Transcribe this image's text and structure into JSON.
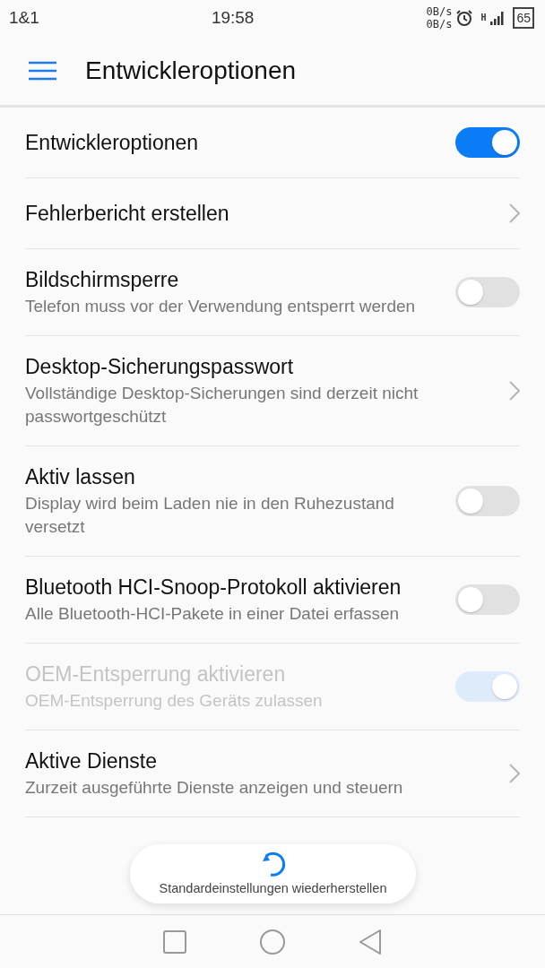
{
  "status_bar": {
    "carrier": "1&1",
    "time": "19:58",
    "upload_speed": "0B/s",
    "download_speed": "0B/s",
    "network_type": "H",
    "battery": "65"
  },
  "toolbar": {
    "title": "Entwickleroptionen"
  },
  "settings": [
    {
      "kind": "switch",
      "title": "Entwickleroptionen",
      "on": true,
      "disabled": false
    },
    {
      "kind": "link",
      "title": "Fehlerbericht erstellen",
      "disabled": false
    },
    {
      "kind": "switch",
      "title": "Bildschirmsperre",
      "subtitle": "Telefon muss vor der Verwendung entsperrt werden",
      "on": false,
      "disabled": false
    },
    {
      "kind": "link",
      "title": "Desktop-Sicherungspasswort",
      "subtitle": "Vollständige Desktop-Sicherungen sind derzeit nicht passwortgeschützt",
      "disabled": false
    },
    {
      "kind": "switch",
      "title": "Aktiv lassen",
      "subtitle": "Display wird beim Laden nie in den Ruhezustand versetzt",
      "on": false,
      "disabled": false
    },
    {
      "kind": "switch",
      "title": "Bluetooth HCI-Snoop-Protokoll aktivieren",
      "subtitle": "Alle Bluetooth-HCI-Pakete in einer Datei erfassen",
      "on": false,
      "disabled": false
    },
    {
      "kind": "switch",
      "title": "OEM-Entsperrung aktivieren",
      "subtitle": "OEM-Entsperrung des Geräts zulassen",
      "on": true,
      "disabled": true
    },
    {
      "kind": "link",
      "title": "Aktive Dienste",
      "subtitle": "Zurzeit ausgeführte Dienste anzeigen und steuern",
      "disabled": false
    }
  ],
  "toast": {
    "text": "Standardeinstellungen wiederherstellen"
  }
}
